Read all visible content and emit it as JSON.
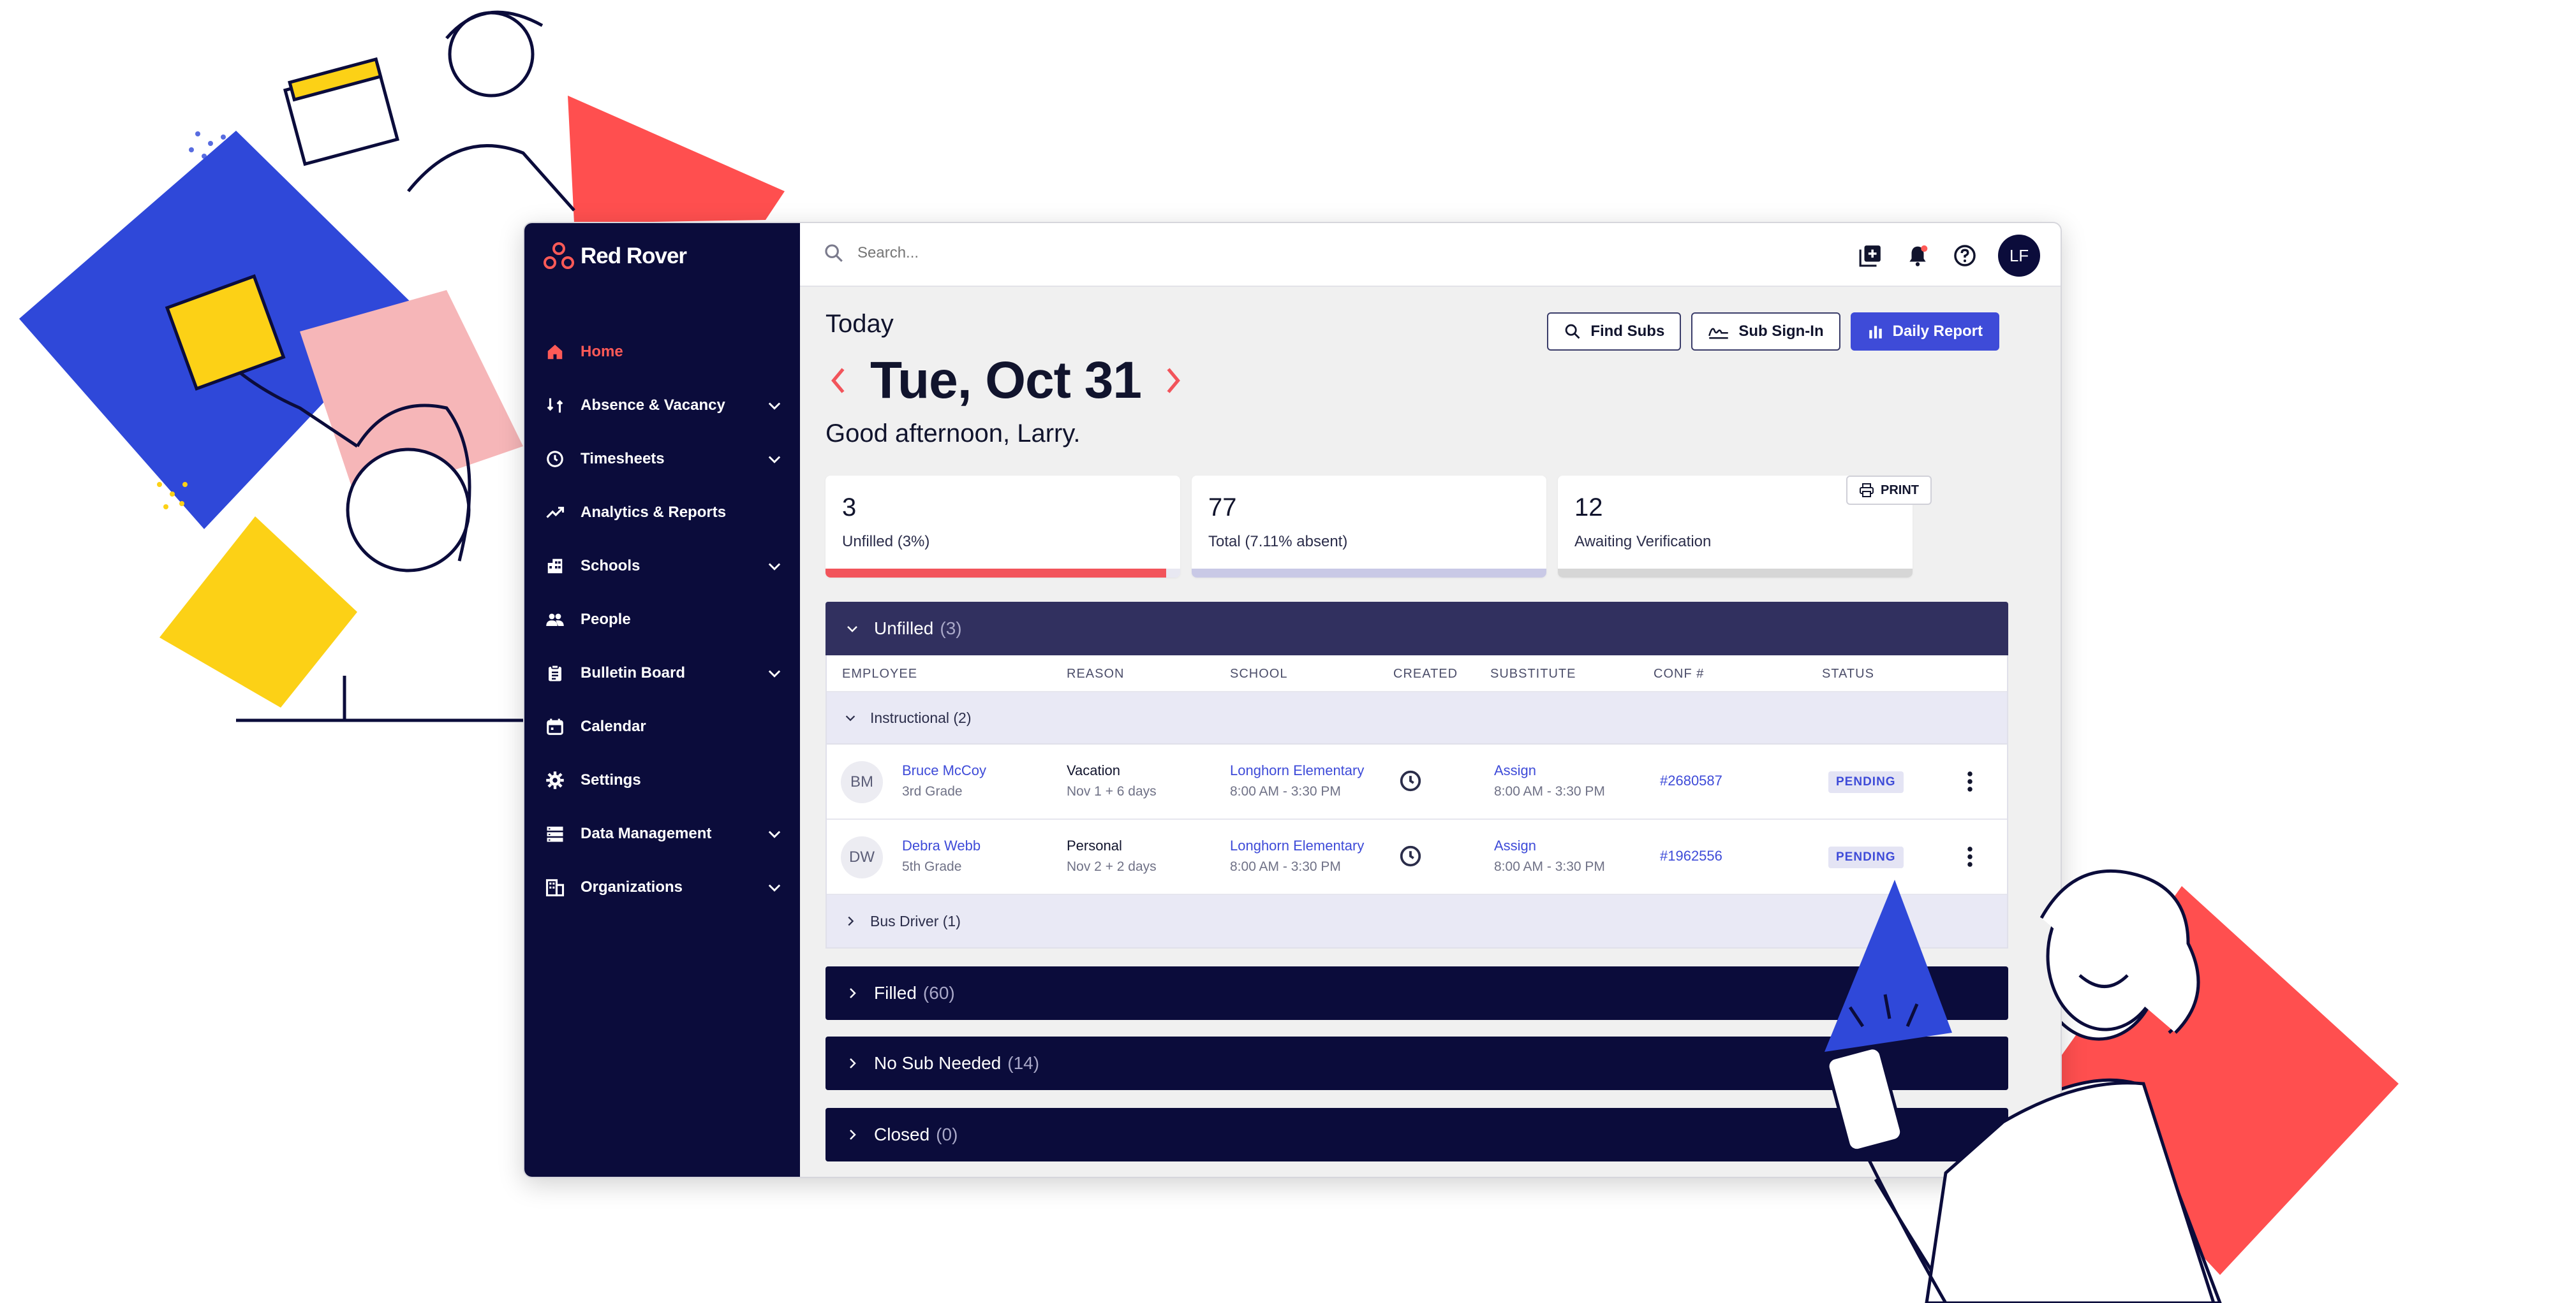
{
  "app": {
    "brand": "Red Rover",
    "search_placeholder": "Search...",
    "user_initials": "LF"
  },
  "sidebar": {
    "items": [
      {
        "label": "Home",
        "icon": "home-icon",
        "active": true,
        "expandable": false
      },
      {
        "label": "Absence & Vacancy",
        "icon": "absence-icon",
        "active": false,
        "expandable": true
      },
      {
        "label": "Timesheets",
        "icon": "clock-icon",
        "active": false,
        "expandable": true
      },
      {
        "label": "Analytics & Reports",
        "icon": "trend-icon",
        "active": false,
        "expandable": false
      },
      {
        "label": "Schools",
        "icon": "building-icon",
        "active": false,
        "expandable": true
      },
      {
        "label": "People",
        "icon": "people-icon",
        "active": false,
        "expandable": false
      },
      {
        "label": "Bulletin Board",
        "icon": "clipboard-icon",
        "active": false,
        "expandable": true
      },
      {
        "label": "Calendar",
        "icon": "calendar-icon",
        "active": false,
        "expandable": false
      },
      {
        "label": "Settings",
        "icon": "gear-icon",
        "active": false,
        "expandable": false
      },
      {
        "label": "Data Management",
        "icon": "database-icon",
        "active": false,
        "expandable": true
      },
      {
        "label": "Organizations",
        "icon": "organization-icon",
        "active": false,
        "expandable": true
      }
    ]
  },
  "header": {
    "today_label": "Today",
    "date": "Tue, Oct 31",
    "greeting": "Good afternoon, Larry.",
    "buttons": {
      "find_subs": "Find Subs",
      "sub_sign_in": "Sub Sign-In",
      "daily_report": "Daily Report",
      "print": "PRINT"
    }
  },
  "stats": [
    {
      "value": "3",
      "label": "Unfilled (3%)",
      "bar_fraction": 0.96,
      "bar_color": "#f2545b"
    },
    {
      "value": "77",
      "label": "Total (7.11% absent)",
      "bar_fraction": 0,
      "bar_color": "#c9c9e6"
    },
    {
      "value": "12",
      "label": "Awaiting Verification",
      "bar_fraction": 0,
      "bar_color": "#d6d6d6"
    }
  ],
  "unfilled": {
    "title": "Unfilled",
    "count": "(3)",
    "columns": [
      "EMPLOYEE",
      "REASON",
      "SCHOOL",
      "CREATED",
      "SUBSTITUTE",
      "CONF #",
      "STATUS"
    ],
    "groups": [
      {
        "label": "Instructional (2)",
        "expanded": true
      },
      {
        "label": "Bus Driver (1)",
        "expanded": false
      }
    ],
    "rows": [
      {
        "initials": "BM",
        "name": "Bruce McCoy",
        "grade": "3rd Grade",
        "reason": "Vacation",
        "reason_detail": "Nov 1 + 6 days",
        "school": "Longhorn Elementary",
        "school_time": "8:00 AM - 3:30 PM",
        "substitute": "Assign",
        "sub_time": "8:00 AM - 3:30 PM",
        "conf": "#2680587",
        "status": "PENDING"
      },
      {
        "initials": "DW",
        "name": "Debra Webb",
        "grade": "5th Grade",
        "reason": "Personal",
        "reason_detail": "Nov 2 + 2 days",
        "school": "Longhorn Elementary",
        "school_time": "8:00 AM - 3:30 PM",
        "substitute": "Assign",
        "sub_time": "8:00 AM - 3:30 PM",
        "conf": "#1962556",
        "status": "PENDING"
      }
    ]
  },
  "sections": [
    {
      "title": "Filled",
      "count": "(60)"
    },
    {
      "title": "No Sub Needed",
      "count": "(14)"
    },
    {
      "title": "Closed",
      "count": "(0)"
    }
  ],
  "colors": {
    "sidebar": "#0b0c3b",
    "accent_red": "#ff5a57",
    "primary_blue": "#3e4bd8",
    "section_header": "#31305f"
  }
}
